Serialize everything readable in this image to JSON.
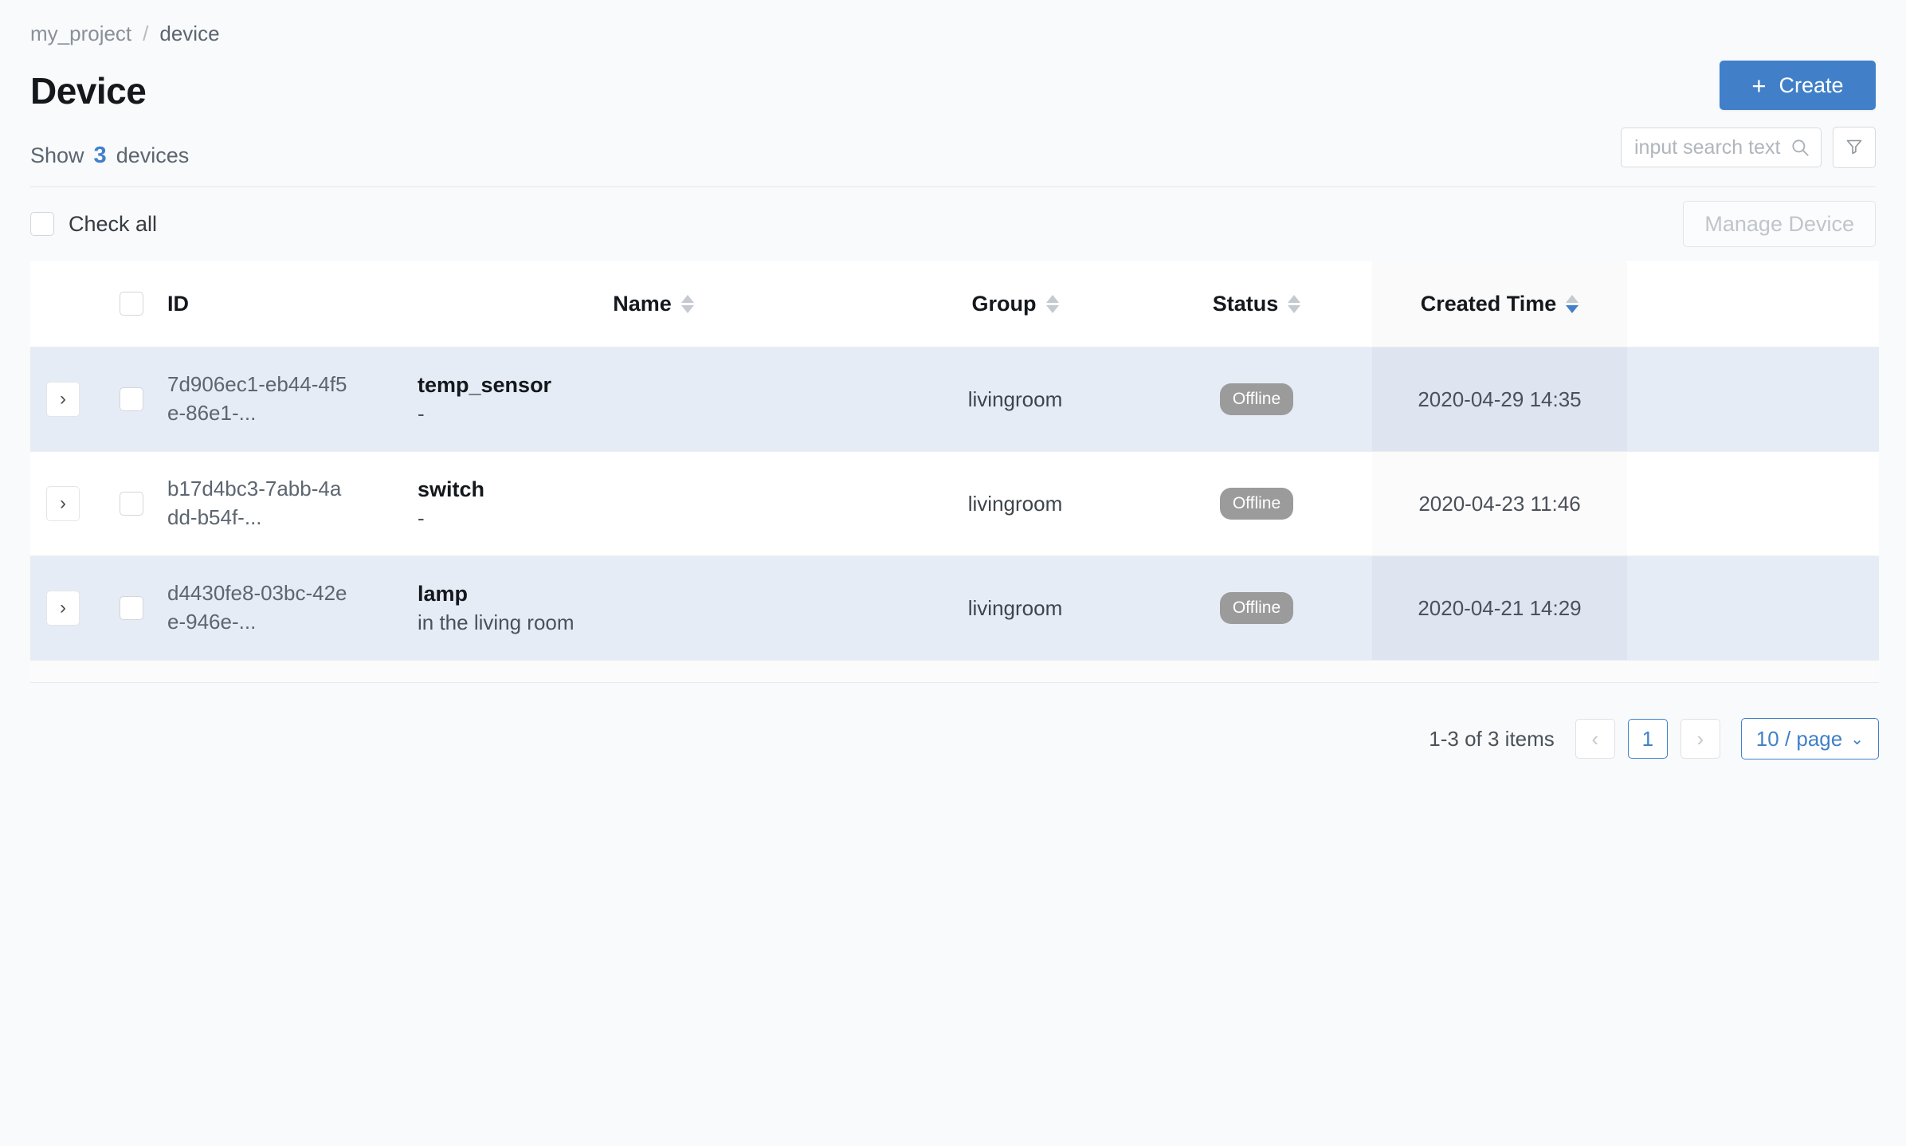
{
  "breadcrumb": {
    "root": "my_project",
    "separator": "/",
    "current": "device"
  },
  "header": {
    "title": "Device",
    "create_label": "Create",
    "create_plus": "+",
    "create_color": "#4180c9"
  },
  "summary": {
    "prefix": "Show",
    "count": "3",
    "suffix": "devices"
  },
  "search": {
    "value": "",
    "placeholder": "input search text",
    "search_icon": "search-icon",
    "filter_icon": "filter-icon"
  },
  "selection": {
    "check_all_label": "Check all",
    "manage_label": "Manage Device"
  },
  "table": {
    "columns": [
      {
        "key": "expand",
        "label": "",
        "sortable": false
      },
      {
        "key": "check",
        "label": "",
        "sortable": false
      },
      {
        "key": "id",
        "label": "ID",
        "sortable": false
      },
      {
        "key": "name",
        "label": "Name",
        "sortable": true,
        "sort": "none"
      },
      {
        "key": "group",
        "label": "Group",
        "sortable": true,
        "sort": "none"
      },
      {
        "key": "status",
        "label": "Status",
        "sortable": true,
        "sort": "none"
      },
      {
        "key": "created",
        "label": "Created Time",
        "sortable": true,
        "sort": "desc"
      }
    ],
    "rows": [
      {
        "id": "7d906ec1-eb44-4f5e-86e1-...",
        "name": "temp_sensor",
        "description": "-",
        "group": "livingroom",
        "status": "Offline",
        "created": "2020-04-29 14:35",
        "expand_icon": "chevron-right-icon",
        "checked": false
      },
      {
        "id": "b17d4bc3-7abb-4add-b54f-...",
        "name": "switch",
        "description": "-",
        "group": "livingroom",
        "status": "Offline",
        "created": "2020-04-23 11:46",
        "expand_icon": "chevron-right-icon",
        "checked": false
      },
      {
        "id": "d4430fe8-03bc-42ee-946e-...",
        "name": "lamp",
        "description": "in the living room",
        "group": "livingroom",
        "status": "Offline",
        "created": "2020-04-21 14:29",
        "expand_icon": "chevron-right-icon",
        "checked": false
      }
    ],
    "status_badge_color": "#9b9b9b",
    "row_highlight_color": "#e6ecf6"
  },
  "pagination": {
    "total_text": "1-3 of 3 items",
    "prev_icon": "chevron-left-icon",
    "next_icon": "chevron-right-icon",
    "current_page": "1",
    "page_size_label": "10 / page",
    "page_size_chevron": "chevron-down-icon"
  }
}
